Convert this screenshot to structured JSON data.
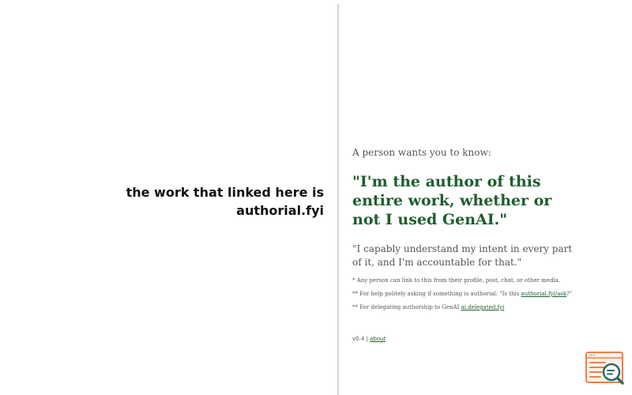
{
  "left": {
    "heading_line1": "the work that linked here is",
    "heading_line2": "authorial.fyi"
  },
  "right": {
    "intro": "A person wants you to know:",
    "claim": "\"I'm the author of this entire work, whether or not I used GenAI.\"",
    "quote": "\"I capably understand my intent in every part of it, and I'm accountable for that.\"",
    "notes": [
      {
        "prefix": "* Any person can link to this from their profile, post, chat, or other media.",
        "link": "",
        "suffix": ""
      },
      {
        "prefix": "** For help politely asking if something is authorial: \"Is this ",
        "link": "authorial.fyi/ask",
        "suffix": "?\""
      },
      {
        "prefix": "** For delegating authorship to GenAI ",
        "link": "ai.delegated.fyi",
        "suffix": ""
      }
    ],
    "version": "v0.4 | ",
    "about_link": "about"
  },
  "colors": {
    "accent_green": "#1e5e2c",
    "body_text": "#555555",
    "divider": "#d3d3d3",
    "widget_orange": "#e8824a",
    "widget_teal": "#2f6b6b"
  },
  "widget": {
    "icon": "document-search-icon"
  }
}
